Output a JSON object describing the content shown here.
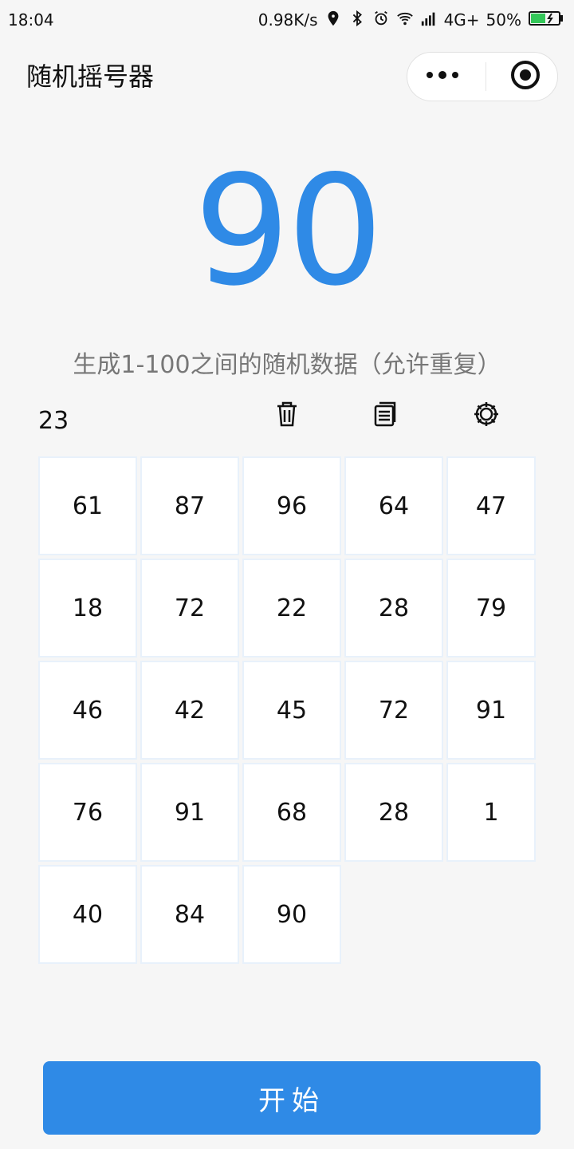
{
  "status_bar": {
    "time": "18:04",
    "speed": "0.98K/s",
    "network": "4G+",
    "battery": "50%",
    "icons": [
      "location-icon",
      "bluetooth-icon",
      "alarm-icon",
      "wifi-icon",
      "signal-icon",
      "battery-icon"
    ],
    "battery_color": "#34c759"
  },
  "header": {
    "title": "随机摇号器",
    "menu_icon": "more-dots-icon",
    "close_icon": "target-icon"
  },
  "result": {
    "number": "90",
    "color": "#2f8ae6"
  },
  "description": "生成1-100之间的随机数据（允许重复）",
  "tools": {
    "count": "23",
    "trash_icon": "trash-icon",
    "copy_icon": "copy-icon",
    "settings_icon": "gear-icon"
  },
  "history": [
    [
      "61",
      "87",
      "96",
      "64",
      "47"
    ],
    [
      "18",
      "72",
      "22",
      "28",
      "79"
    ],
    [
      "46",
      "42",
      "45",
      "72",
      "91"
    ],
    [
      "76",
      "91",
      "68",
      "28",
      "1"
    ],
    [
      "40",
      "84",
      "90"
    ]
  ],
  "button": {
    "start_label": "开始",
    "color": "#2f8ae6"
  }
}
